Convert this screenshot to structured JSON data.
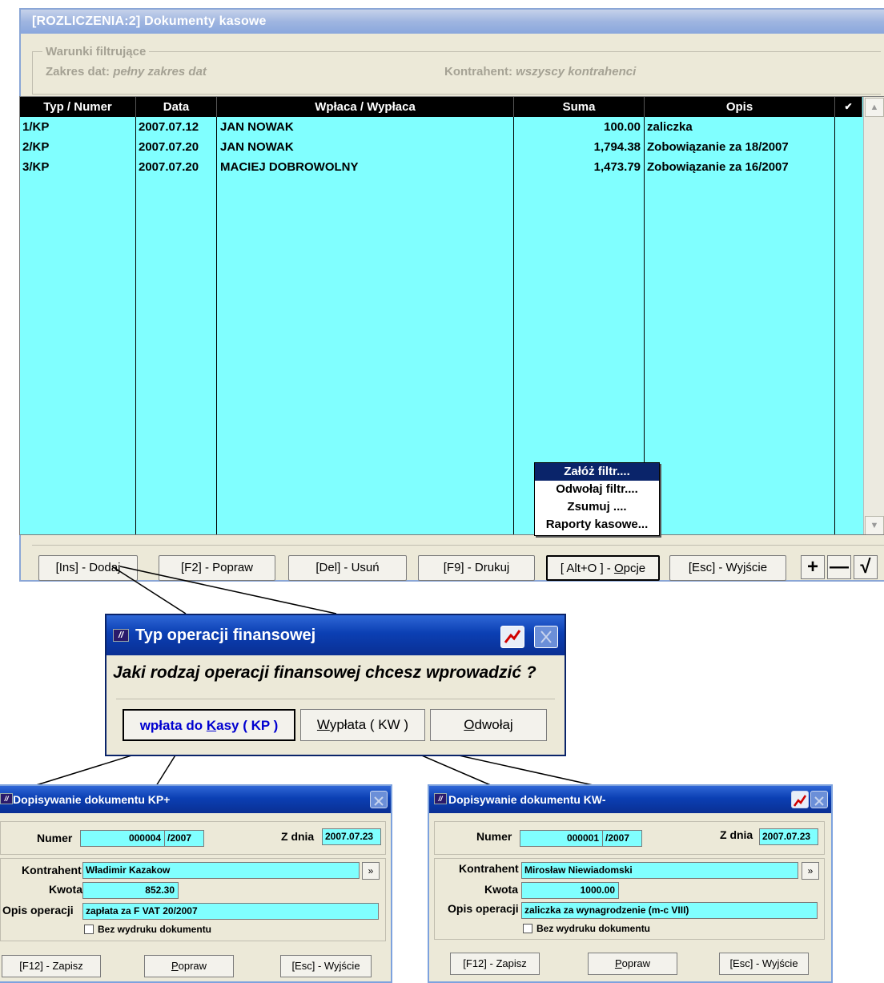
{
  "main_window": {
    "title": "[ROZLICZENIA:2]  Dokumenty kasowe",
    "filter": {
      "legend": "Warunki filtrujące",
      "date_label": "Zakres dat: ",
      "date_value": "pełny zakres dat",
      "contractor_label": "Kontrahent: ",
      "contractor_value": "wszyscy kontrahenci"
    },
    "columns": [
      "Typ / Numer",
      "Data",
      "Wpłaca / Wypłaca",
      "Suma",
      "Opis",
      "✔"
    ],
    "rows": [
      {
        "num": "1/KP",
        "date": "2007.07.12",
        "who": "JAN NOWAK",
        "sum": "100.00",
        "desc": "zaliczka"
      },
      {
        "num": "2/KP",
        "date": "2007.07.20",
        "who": "JAN NOWAK",
        "sum": "1,794.38",
        "desc": "Zobowiązanie za 18/2007"
      },
      {
        "num": "3/KP",
        "date": "2007.07.20",
        "who": "MACIEJ DOBROWOLNY",
        "sum": "1,473.79",
        "desc": "Zobowiązanie za 16/2007"
      }
    ],
    "options_menu": [
      "Załóż filtr....",
      "Odwołaj filtr....",
      "Zsumuj ....",
      "Raporty kasowe..."
    ],
    "buttons": {
      "add": "[Ins] - Dodaj",
      "edit": "[F2] - Popraw",
      "delete": "[Del] - Usuń",
      "print": "[F9] - Drukuj",
      "options_prefix": "[ Alt+O ] - ",
      "options_key": "O",
      "options_rest": "pcje",
      "exit": "[Esc] - Wyjście",
      "plus": "+",
      "minus": "—",
      "check": "√"
    }
  },
  "type_dialog": {
    "title": "Typ operacji finansowej",
    "question": "Jaki rodzaj operacji finansowej chcesz wprowadzić ?",
    "btn_kp_prefix": "wpłata do ",
    "btn_kp_key": "K",
    "btn_kp_rest": "asy ( KP )",
    "btn_kw_key": "W",
    "btn_kw_rest": "ypłata ( KW )",
    "btn_cancel_key": "O",
    "btn_cancel_rest": "dwołaj"
  },
  "kp_dialog": {
    "title": "Dopisywanie dokumentu KP+",
    "numer_label": "Numer",
    "numer_value": "000004",
    "numer_year": "/2007",
    "date_label": "Z dnia",
    "date_value": "2007.07.23",
    "contractor_label": "Kontrahent",
    "contractor_value": "Władimir Kazakow",
    "amount_label": "Kwota",
    "amount_value": "852.30",
    "desc_label": "Opis operacji",
    "desc_value": "zapłata za F VAT 20/2007",
    "checkbox_label": "Bez wydruku dokumentu",
    "btn_save": "[F12] - Zapisz",
    "btn_edit_key": "P",
    "btn_edit_rest": "opraw",
    "btn_exit": "[Esc] - Wyjście",
    "dots": "»"
  },
  "kw_dialog": {
    "title": "Dopisywanie dokumentu KW-",
    "numer_label": "Numer",
    "numer_value": "000001",
    "numer_year": "/2007",
    "date_label": "Z dnia",
    "date_value": "2007.07.23",
    "contractor_label": "Kontrahent",
    "contractor_value": "Mirosław Niewiadomski",
    "amount_label": "Kwota",
    "amount_value": "1000.00",
    "desc_label": "Opis operacji",
    "desc_value": "zaliczka za wynagrodzenie (m-c VIII)",
    "checkbox_label": "Bez wydruku dokumentu",
    "btn_save": "[F12] - Zapisz",
    "btn_edit_key": "P",
    "btn_edit_rest": "opraw",
    "btn_exit": "[Esc] - Wyjście",
    "dots": "»"
  },
  "colors": {
    "grid_bg": "#80ffff",
    "window_bg": "#ece9d8",
    "menu_selected": "#0a246a",
    "titlebar_blue": "#0b3fb3"
  }
}
